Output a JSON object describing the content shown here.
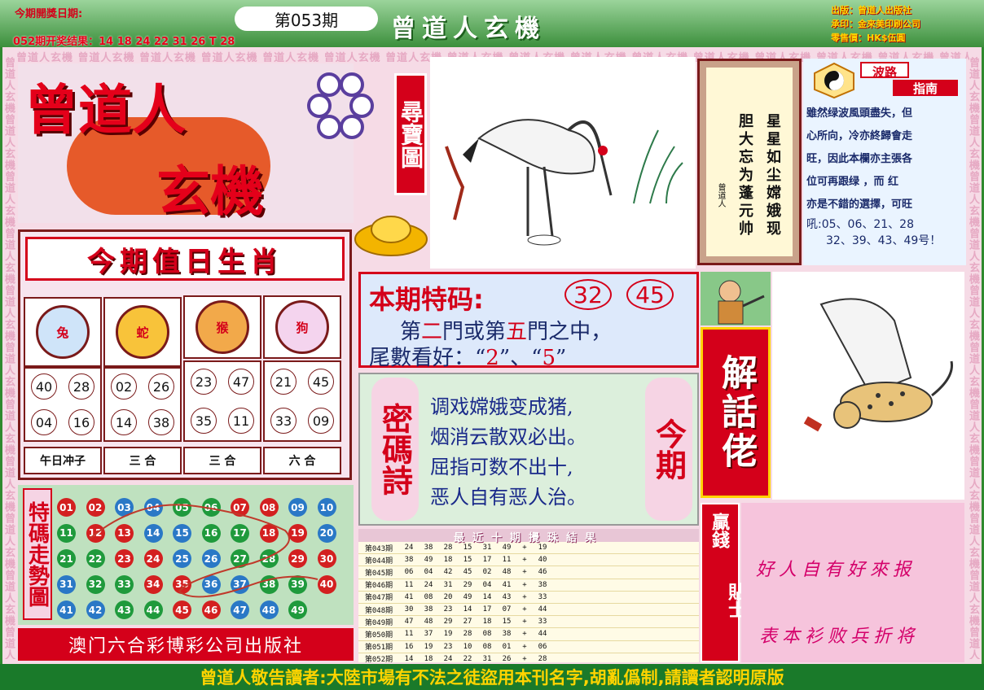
{
  "header": {
    "date_label": "今期開獎日期:",
    "issue": "第053期",
    "prev_result": "052期开奖结果：14 18 24 22 31 26 T 28",
    "banner_title": "曾道人玄機",
    "publisher_lines": [
      "出版：曾道人出版社",
      "承印：金來美印刷公司",
      "零售價：HK$伍圓"
    ],
    "watermark": "曾道人玄機"
  },
  "logo": {
    "main_title_1": "曾道人",
    "main_title_2": "玄機",
    "tag": "尋寶圖"
  },
  "poem_box": {
    "col1": "星星如尘嫦娥现",
    "col2": "胆大忘为蓬元帅",
    "signature": "曾道人"
  },
  "bolu": {
    "title_1": "波路",
    "title_2": "指南",
    "text_lines": [
      "雖然绿波風頭盡失，但",
      "心所向，冷亦終歸會走",
      "旺，因此本欄亦主張各",
      "位可再跟绿 ，而 红",
      "亦是不錯的選擇，可旺"
    ],
    "numbers_1": "吼:05、06、21、28",
    "numbers_2": "32、39、43、49号！"
  },
  "zodiac": {
    "title": "今期值日生肖",
    "animals": [
      {
        "name": "兔",
        "numbers": [
          "40",
          "28",
          "04",
          "16"
        ],
        "relation": "午日冲子"
      },
      {
        "name": "蛇",
        "numbers": [
          "02",
          "26",
          "14",
          "38"
        ],
        "relation": "三 合"
      },
      {
        "name": "猴",
        "numbers": [
          "23",
          "47",
          "35",
          "11"
        ],
        "relation": "三 合"
      },
      {
        "name": "狗",
        "numbers": [
          "21",
          "45",
          "33",
          "09"
        ],
        "relation": "六 合"
      }
    ]
  },
  "special": {
    "label": "本期特码:",
    "num1": "32",
    "num2": "45",
    "line1_a": "第",
    "line1_b": "二",
    "line1_c": "門或第",
    "line1_d": "五",
    "line1_e": "門之中，",
    "line2_a": "尾數看好：“",
    "line2_b": "2",
    "line2_c": "”、“",
    "line2_d": "5",
    "line2_e": "”"
  },
  "mima": {
    "left_label": "密碼詩",
    "right_label": "今期",
    "lines": [
      "调戏嫦娥变成猪,",
      "烟消云散双必出。",
      "屈指可数不出十,",
      "恶人自有恶人治。"
    ]
  },
  "jiehua": {
    "label": "解話佬"
  },
  "trend": {
    "label": "特碼走勢圖",
    "balls": [
      [
        "01",
        "red"
      ],
      [
        "02",
        "red"
      ],
      [
        "03",
        "blue"
      ],
      [
        "04",
        "blue"
      ],
      [
        "05",
        "green"
      ],
      [
        "06",
        "green"
      ],
      [
        "07",
        "red"
      ],
      [
        "08",
        "red"
      ],
      [
        "09",
        "blue"
      ],
      [
        "10",
        "blue"
      ],
      [
        "11",
        "green"
      ],
      [
        "12",
        "red"
      ],
      [
        "13",
        "red"
      ],
      [
        "14",
        "blue"
      ],
      [
        "15",
        "blue"
      ],
      [
        "16",
        "green"
      ],
      [
        "17",
        "green"
      ],
      [
        "18",
        "red"
      ],
      [
        "19",
        "red"
      ],
      [
        "20",
        "blue"
      ],
      [
        "21",
        "green"
      ],
      [
        "22",
        "green"
      ],
      [
        "23",
        "red"
      ],
      [
        "24",
        "red"
      ],
      [
        "25",
        "blue"
      ],
      [
        "26",
        "blue"
      ],
      [
        "27",
        "green"
      ],
      [
        "28",
        "green"
      ],
      [
        "29",
        "red"
      ],
      [
        "30",
        "red"
      ],
      [
        "31",
        "blue"
      ],
      [
        "32",
        "green"
      ],
      [
        "33",
        "green"
      ],
      [
        "34",
        "red"
      ],
      [
        "35",
        "red"
      ],
      [
        "36",
        "blue"
      ],
      [
        "37",
        "blue"
      ],
      [
        "38",
        "green"
      ],
      [
        "39",
        "green"
      ],
      [
        "40",
        "red"
      ],
      [
        "41",
        "blue"
      ],
      [
        "42",
        "blue"
      ],
      [
        "43",
        "green"
      ],
      [
        "44",
        "green"
      ],
      [
        "45",
        "red"
      ],
      [
        "46",
        "red"
      ],
      [
        "47",
        "blue"
      ],
      [
        "48",
        "blue"
      ],
      [
        "49",
        "green"
      ]
    ]
  },
  "publisher_footer": "澳门六合彩博彩公司出版社",
  "results": {
    "title": "最近十期攪珠結果",
    "rows": [
      {
        "issue": "第043期",
        "nums": [
          "24",
          "38",
          "28",
          "15",
          "31",
          "49"
        ],
        "special": "19"
      },
      {
        "issue": "第044期",
        "nums": [
          "38",
          "49",
          "18",
          "15",
          "17",
          "11"
        ],
        "special": "40"
      },
      {
        "issue": "第045期",
        "nums": [
          "06",
          "04",
          "42",
          "45",
          "02",
          "48"
        ],
        "special": "46"
      },
      {
        "issue": "第046期",
        "nums": [
          "11",
          "24",
          "31",
          "29",
          "04",
          "41"
        ],
        "special": "38"
      },
      {
        "issue": "第047期",
        "nums": [
          "41",
          "08",
          "20",
          "49",
          "14",
          "43"
        ],
        "special": "33"
      },
      {
        "issue": "第048期",
        "nums": [
          "30",
          "38",
          "23",
          "14",
          "17",
          "07"
        ],
        "special": "44"
      },
      {
        "issue": "第049期",
        "nums": [
          "47",
          "48",
          "29",
          "27",
          "18",
          "15"
        ],
        "special": "33"
      },
      {
        "issue": "第050期",
        "nums": [
          "11",
          "37",
          "19",
          "28",
          "08",
          "38"
        ],
        "special": "44"
      },
      {
        "issue": "第051期",
        "nums": [
          "16",
          "19",
          "23",
          "10",
          "08",
          "01"
        ],
        "special": "06"
      },
      {
        "issue": "第052期",
        "nums": [
          "14",
          "18",
          "24",
          "22",
          "31",
          "26"
        ],
        "special": "28"
      }
    ],
    "plus": "+"
  },
  "yingqian": {
    "label_1": "贏錢",
    "label_2": "貼士",
    "line1": "好人自有好來报",
    "line2": "表本衫败兵折将"
  },
  "footer": "曾道人敬告讀者:大陸市場有不法之徒盜用本刊名字,胡亂僞制,請讀者認明原版"
}
